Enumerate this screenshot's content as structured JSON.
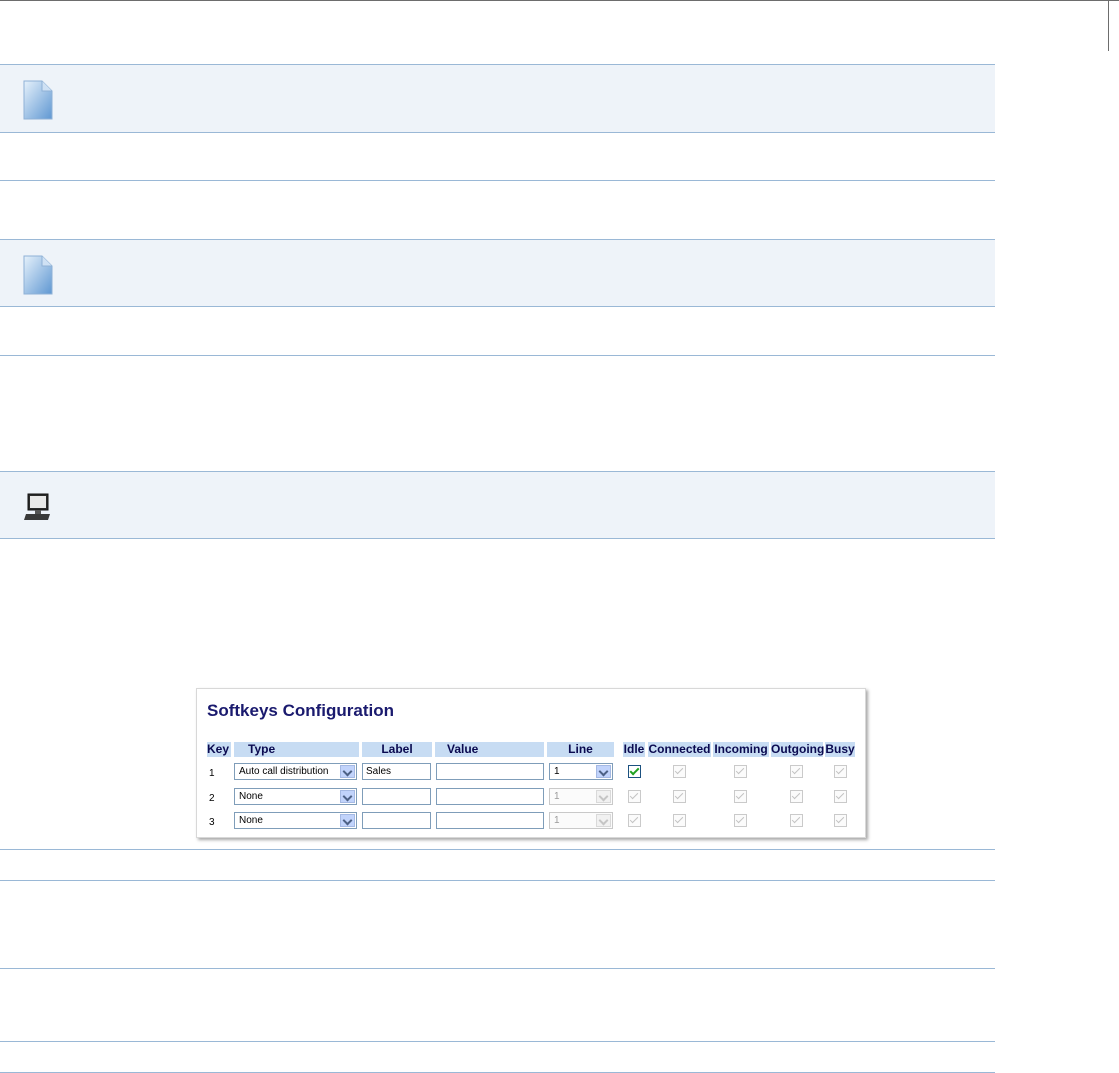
{
  "softkeys": {
    "title": "Softkeys Configuration",
    "columns": [
      "Key",
      "Type",
      "Label",
      "Value",
      "Line",
      "Idle",
      "Connected",
      "Incoming",
      "Outgoing",
      "Busy"
    ],
    "rows": [
      {
        "key": "1",
        "type": "Auto call distribution",
        "label": "Sales",
        "value": "",
        "line": "1",
        "idle": true,
        "connected": true,
        "incoming": true,
        "outgoing": true,
        "busy": true
      },
      {
        "key": "2",
        "type": "None",
        "label": "",
        "value": "",
        "line": "1",
        "idle": true,
        "connected": true,
        "incoming": true,
        "outgoing": true,
        "busy": true
      },
      {
        "key": "3",
        "type": "None",
        "label": "",
        "value": "",
        "line": "1",
        "idle": true,
        "connected": true,
        "incoming": true,
        "outgoing": true,
        "busy": true
      }
    ]
  },
  "icons": {
    "note1": "note-page-icon",
    "note2": "note-page-icon",
    "note3": "computer-icon"
  },
  "colors": {
    "note_bg": "#eef3f9",
    "rule": "#9ab8d6",
    "header_bg": "#c7dcf3",
    "title": "#1a1a6e"
  }
}
